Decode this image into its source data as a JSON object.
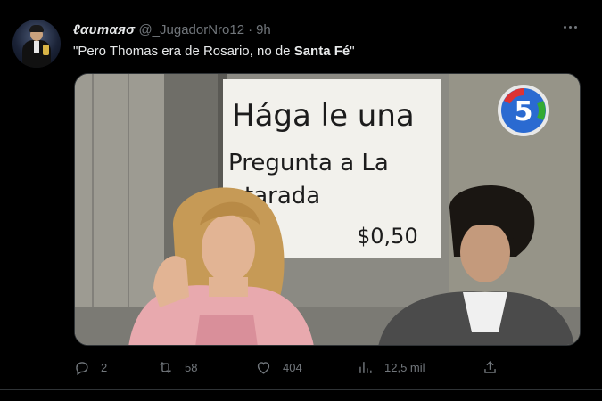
{
  "tweet": {
    "display_name": "ℓαυтαяσ",
    "handle": "@_JugadorNro12",
    "separator": "·",
    "time": "9h",
    "text_prefix": "\"Pero Thomas era de Rosario, no de ",
    "text_bold": "Santa Fé",
    "text_suffix": "\""
  },
  "media": {
    "sign_line_1": "Hága le una",
    "sign_line_2": "Pregunta a La",
    "sign_line_3": "tarada",
    "sign_price": "$0,50",
    "channel_logo": "5"
  },
  "actions": {
    "reply_count": "2",
    "retweet_count": "58",
    "like_count": "404",
    "views_count": "12,5 mil"
  },
  "icons": {
    "reply": "reply-icon",
    "retweet": "retweet-icon",
    "like": "heart-icon",
    "views": "views-icon",
    "share": "share-icon",
    "more": "more-icon"
  },
  "colors": {
    "background": "#000000",
    "text": "#e7e9ea",
    "muted": "#71767b",
    "border": "#2f3336"
  }
}
